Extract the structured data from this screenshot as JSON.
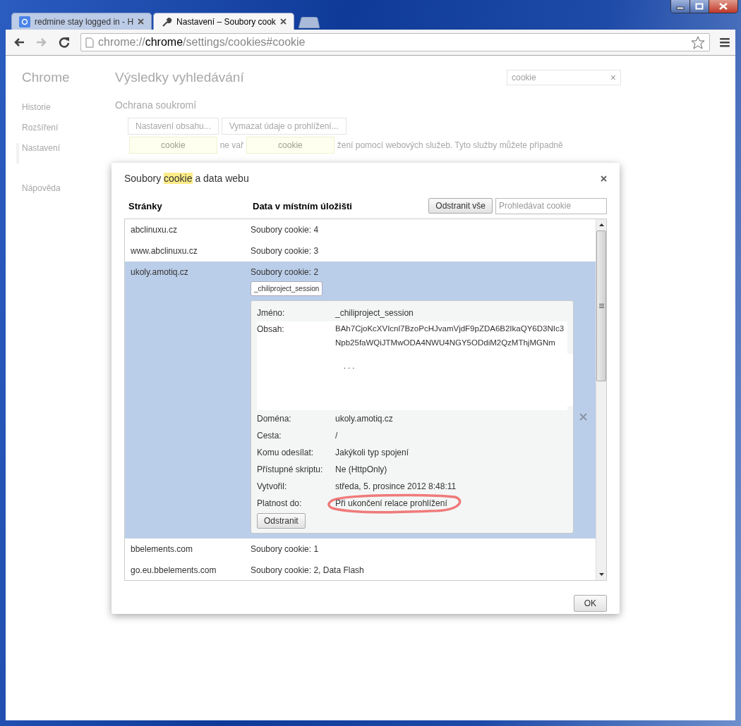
{
  "window": {
    "tabs": [
      {
        "title": "redmine stay logged in - H",
        "kind": "search",
        "selected": false
      },
      {
        "title": "Nastavení – Soubory cook",
        "kind": "settings",
        "selected": true
      }
    ],
    "url": {
      "scheme": "chrome://",
      "host": "chrome",
      "path": "/settings/cookies#cookie"
    }
  },
  "background": {
    "sidebar_title": "Chrome",
    "sidebar": [
      {
        "label": "Historie",
        "selected": false
      },
      {
        "label": "Rozšíření",
        "selected": false
      },
      {
        "label": "Nastavení",
        "selected": true
      },
      {
        "label": "Nápověda",
        "selected": false
      }
    ],
    "heading": "Výsledky vyhledávání",
    "search": {
      "value": "cookie",
      "clear": "×"
    },
    "section": "Ochrana soukromí",
    "buttons": [
      "Nastavení obsahu...",
      "Vymazat údaje o prohlížení..."
    ],
    "bubbles": [
      {
        "kind": "bubble",
        "text": "cookie"
      },
      {
        "kind": "text",
        "text": "ne vař"
      },
      {
        "kind": "bubble",
        "text": "cookie"
      },
      {
        "kind": "text",
        "text": "žení pomocí webových služeb. Tyto služby můžete případně"
      }
    ]
  },
  "dialog": {
    "title": {
      "before": "Soubory ",
      "highlight": "cookie",
      "after": " a data webu"
    },
    "columns": [
      "Stránky",
      "Data v místním úložišti"
    ],
    "remove_all": "Odstranit vše",
    "search": {
      "placeholder": "Prohledávat cookie"
    },
    "rows": [
      {
        "site": "abclinuxu.cz",
        "data": "Soubory cookie: 4",
        "selected": false
      },
      {
        "site": "www.abclinuxu.cz",
        "data": "Soubory cookie: 3",
        "selected": false
      },
      {
        "site": "ukoly.amotiq.cz",
        "data": "Soubory cookie: 2",
        "selected": true,
        "cookies": [
          {
            "label": "_chiliproject_session",
            "selected": true
          }
        ],
        "details": [
          {
            "kind": "text",
            "label": "Jméno:",
            "value": "_chiliproject_session",
            "circled": false
          },
          {
            "kind": "content",
            "label": "Obsah:",
            "lines": [
              "BAh7CjoKcXVIcnl7BzoPcHJvamVjdF9pZDA6B2IkaQY6D3NIc3",
              "Npb25faWQiJTMwODA4NWU4NGY5ODdiM2QzMThjMGNm"
            ],
            "more": ". . ."
          },
          {
            "kind": "text",
            "label": "Doména:",
            "value": "ukoly.amotiq.cz",
            "circled": false
          },
          {
            "kind": "text",
            "label": "Cesta:",
            "value": "/",
            "circled": false
          },
          {
            "kind": "text",
            "label": "Komu odesílat:",
            "value": "Jakýkoli typ spojení",
            "circled": false
          },
          {
            "kind": "text",
            "label": "Přístupné skriptu:",
            "value": "Ne (HttpOnly)",
            "circled": false
          },
          {
            "kind": "text",
            "label": "Vytvořil:",
            "value": "středa, 5. prosince 2012 8:48:11",
            "circled": false
          },
          {
            "kind": "text",
            "label": "Platnost do:",
            "value": "Při ukončení relace prohlížení",
            "circled": true
          }
        ],
        "remove": "Odstranit"
      },
      {
        "site": "bbelements.com",
        "data": "Soubory cookie: 1",
        "selected": false
      },
      {
        "site": "go.eu.bbelements.com",
        "data": "Soubory cookie: 2, Data Flash",
        "selected": false
      }
    ],
    "ok": "OK"
  }
}
